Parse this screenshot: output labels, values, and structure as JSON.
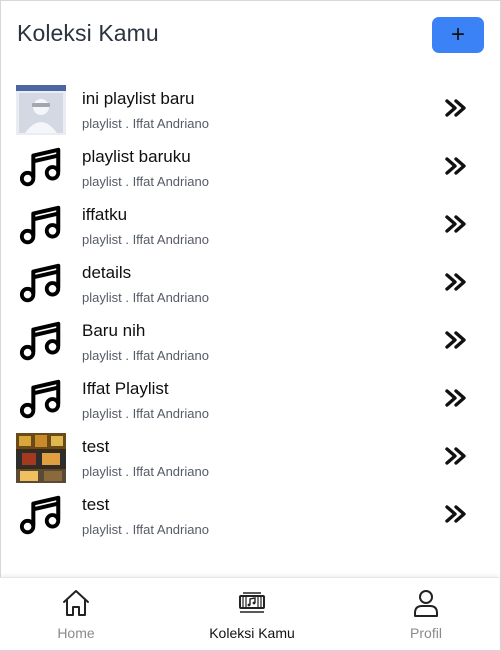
{
  "header": {
    "title": "Koleksi Kamu",
    "add_label": "+"
  },
  "playlists": [
    {
      "name": "ini playlist baru",
      "subtitle": "playlist . Iffat Andriano",
      "thumb": "photo-avatar"
    },
    {
      "name": "playlist baruku",
      "subtitle": "playlist . Iffat Andriano",
      "thumb": "music-note-icon"
    },
    {
      "name": "iffatku",
      "subtitle": "playlist . Iffat Andriano",
      "thumb": "music-note-icon"
    },
    {
      "name": "details",
      "subtitle": "playlist . Iffat Andriano",
      "thumb": "music-note-icon"
    },
    {
      "name": "Baru nih",
      "subtitle": "playlist . Iffat Andriano",
      "thumb": "music-note-icon"
    },
    {
      "name": "Iffat Playlist",
      "subtitle": "playlist . Iffat Andriano",
      "thumb": "music-note-icon"
    },
    {
      "name": "test",
      "subtitle": "playlist . Iffat Andriano",
      "thumb": "photo-cover"
    },
    {
      "name": "test",
      "subtitle": "playlist . Iffat Andriano",
      "thumb": "music-note-icon"
    }
  ],
  "nav": {
    "home_label": "Home",
    "koleksi_label": "Koleksi Kamu",
    "profil_label": "Profil"
  },
  "colors": {
    "accent": "#3b82f6",
    "inactive": "#8a8a8a",
    "title": "#2b3340"
  }
}
